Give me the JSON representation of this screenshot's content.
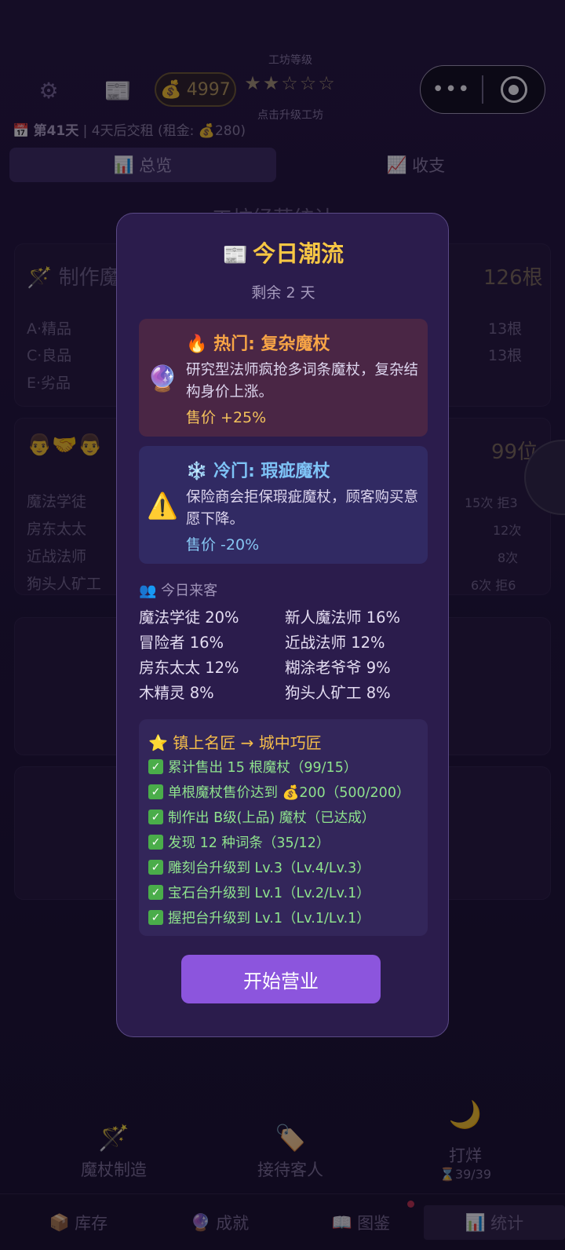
{
  "header": {
    "coins": "4997",
    "workshop_level_label": "工坊等级",
    "stars": "★★☆☆☆",
    "upgrade_hint": "点击升级工坊",
    "capsule_more": "•••"
  },
  "day": {
    "day_label": "第41天",
    "rent_text": "| 4天后交租 (租金: 💰280)"
  },
  "tabs": [
    {
      "icon": "📊",
      "label": "总览"
    },
    {
      "icon": "📈",
      "label": "收支"
    }
  ],
  "background": {
    "section_title": "工坊经营统计",
    "make_title": "🪄 制作魔",
    "make_total": "126根",
    "grade_a": "A·精品",
    "grade_c": "C·良品",
    "grade_e": "E·劣品",
    "count_a": "13根",
    "count_c": "13根",
    "customers_icon": "👨🤝👨",
    "customers_total": "99位",
    "c1": "魔法学徒",
    "c1v": "15次 拒3",
    "c2": "房东太太",
    "c2v": "12次",
    "c3": "近战法师",
    "c3v": "8次",
    "c4": "狗头人矿工",
    "c4v": "6次 拒6"
  },
  "bottom": {
    "craft": "魔杖制造",
    "serve": "接待客人",
    "close": "打烊",
    "hourglass": "⌛39/39"
  },
  "nav": [
    {
      "icon": "📦",
      "label": "库存"
    },
    {
      "icon": "🔮",
      "label": "成就"
    },
    {
      "icon": "📖",
      "label": "图鉴"
    },
    {
      "icon": "📊",
      "label": "统计"
    }
  ],
  "modal": {
    "title_icon": "📰",
    "title": "今日潮流",
    "remaining": "剩余 2 天",
    "hot": {
      "head_icon": "🔥",
      "head": "热门: 复杂魔杖",
      "icon": "🔮",
      "desc": "研究型法师疯抢多词条魔杖，复杂结构身价上涨。",
      "price": "售价 +25%"
    },
    "cold": {
      "head_icon": "❄️",
      "head": "冷门: 瑕疵魔杖",
      "icon": "⚠️",
      "desc": "保险商会拒保瑕疵魔杖，顾客购买意愿下降。",
      "price": "售价 -20%"
    },
    "visitors_title": "👥 今日来客",
    "visitors": [
      "魔法学徒 20%",
      "新人魔法师 16%",
      "冒险者 16%",
      "近战法师 12%",
      "房东太太 12%",
      "糊涂老爷爷 9%",
      "木精灵 8%",
      "狗头人矿工 8%"
    ],
    "goal_title": "⭐ 镇上名匠 → 城中巧匠",
    "goals": [
      "累计售出 15 根魔杖（99/15）",
      "单根魔杖售价达到 💰200（500/200）",
      "制作出 B级(上品) 魔杖（已达成）",
      "发现 12 种词条（35/12）",
      "雕刻台升级到 Lv.3（Lv.4/Lv.3）",
      "宝石台升级到 Lv.1（Lv.2/Lv.1）",
      "握把台升级到 Lv.1（Lv.1/Lv.1）"
    ],
    "start_button": "开始营业"
  }
}
